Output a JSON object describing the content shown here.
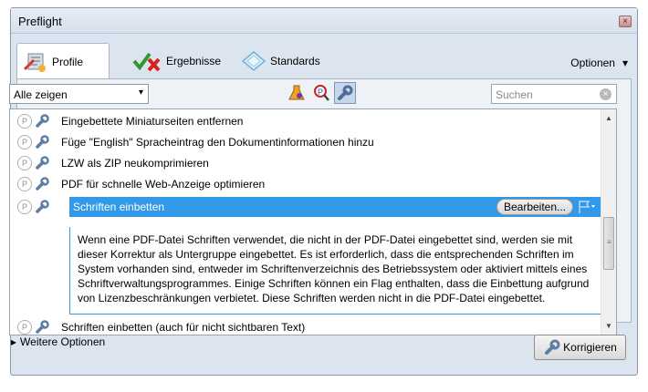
{
  "window": {
    "title": "Preflight",
    "close_symbol": "×"
  },
  "tabs": [
    {
      "label": "Profile",
      "icon": "profile-icon",
      "active": true
    },
    {
      "label": "Ergebnisse",
      "icon": "results-icon",
      "active": false
    },
    {
      "label": "Standards",
      "icon": "standards-icon",
      "active": false
    }
  ],
  "options_menu": {
    "label": "Optionen",
    "arrow": "▾"
  },
  "filter": {
    "selected": "Alle zeigen",
    "arrow": "▾"
  },
  "toolbar": {
    "icons": [
      "flask-icon",
      "profile-magnify-icon",
      "fixup-wrench-icon"
    ]
  },
  "search": {
    "placeholder": "Suchen",
    "clear_symbol": "×"
  },
  "list": {
    "items": [
      {
        "label": "Eingebettete Miniaturseiten entfernen"
      },
      {
        "label": "Füge \"English\" Spracheintrag den Dokumentinformationen hinzu"
      },
      {
        "label": "LZW als ZIP neukomprimieren"
      },
      {
        "label": "PDF für schnelle Web-Anzeige optimieren"
      },
      {
        "label": "Schriften einbetten",
        "selected": true
      },
      {
        "label": "Schriften einbetten (auch für nicht sichtbaren Text)"
      }
    ],
    "selected_description": "Wenn eine PDF-Datei Schriften verwendet, die nicht in der PDF-Datei eingebettet sind, werden sie mit dieser Korrektur als Untergruppe eingebettet. Es ist erforderlich, dass die entsprechenden Schriften im System vorhanden sind, entweder im Schriftenverzeichnis des Betriebssystem oder aktiviert mittels eines Schriftverwaltungsprogrammes. Einige Schriften können ein Flag enthalten, dass die Einbettung aufgrund von Lizenzbeschränkungen verbietet. Diese Schriften werden nicht in die PDF-Datei eingebettet.",
    "edit_label": "Bearbeiten...",
    "item_icon_letter": "P"
  },
  "more_options": {
    "label": "Weitere Optionen",
    "arrow": "▸"
  },
  "fix_button": {
    "label": "Korrigieren"
  },
  "colors": {
    "selection": "#3199e8",
    "window_bg": "#dbe4ef"
  }
}
